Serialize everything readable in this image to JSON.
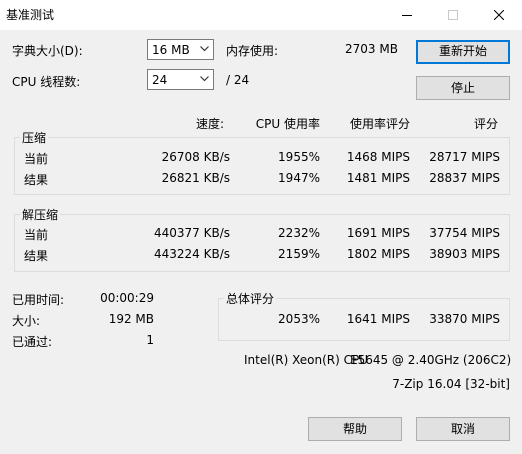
{
  "window": {
    "title": "基准测试"
  },
  "settings": {
    "dict_size_label": "字典大小(D):",
    "dict_size_value": "16 MB",
    "memory_label": "内存使用:",
    "memory_value": "2703 MB",
    "threads_label": "CPU 线程数:",
    "threads_value": "24",
    "threads_total": "/ 24"
  },
  "buttons": {
    "restart": "重新开始",
    "stop": "停止",
    "help": "帮助",
    "cancel": "取消"
  },
  "columns": {
    "speed": "速度:",
    "cpu_usage": "CPU 使用率",
    "usage_rating": "使用率评分",
    "rating": "评分"
  },
  "compress": {
    "title": "压缩",
    "rows": [
      {
        "label": "当前",
        "speed": "26708 KB/s",
        "cpu": "1955%",
        "usage_rating": "1468 MIPS",
        "rating": "28717 MIPS"
      },
      {
        "label": "结果",
        "speed": "26821 KB/s",
        "cpu": "1947%",
        "usage_rating": "1481 MIPS",
        "rating": "28837 MIPS"
      }
    ]
  },
  "decompress": {
    "title": "解压缩",
    "rows": [
      {
        "label": "当前",
        "speed": "440377 KB/s",
        "cpu": "2232%",
        "usage_rating": "1691 MIPS",
        "rating": "37754 MIPS"
      },
      {
        "label": "结果",
        "speed": "443224 KB/s",
        "cpu": "2159%",
        "usage_rating": "1802 MIPS",
        "rating": "38903 MIPS"
      }
    ]
  },
  "stats": {
    "elapsed_label": "已用时间:",
    "elapsed_value": "00:00:29",
    "size_label": "大小:",
    "size_value": "192 MB",
    "passes_label": "已通过:",
    "passes_value": "1"
  },
  "total": {
    "title": "总体评分",
    "cpu": "2053%",
    "usage_rating": "1641 MIPS",
    "rating": "33870 MIPS"
  },
  "cpu_info": {
    "name": "Intel(R) Xeon(R) CPU",
    "model": "E5645  @ 2.40GHz (206C2)",
    "version": "7-Zip 16.04 [32-bit]"
  }
}
